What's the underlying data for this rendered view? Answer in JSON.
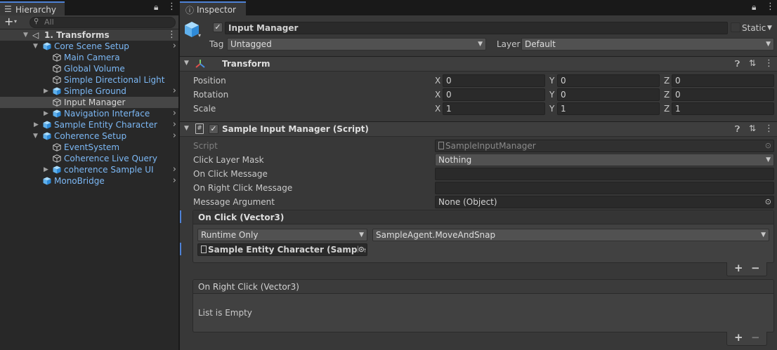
{
  "hierarchy": {
    "tab_title": "Hierarchy",
    "search_placeholder": "All",
    "scene": "1. Transforms",
    "items": [
      {
        "label": "Core Scene Setup",
        "indent": 1,
        "expanded": true,
        "children": true,
        "color": "blue"
      },
      {
        "label": "Main Camera",
        "indent": 2,
        "color": "blue"
      },
      {
        "label": "Global Volume",
        "indent": 2,
        "color": "blue"
      },
      {
        "label": "Simple Directional Light",
        "indent": 2,
        "color": "blue"
      },
      {
        "label": "Simple Ground",
        "indent": 2,
        "expanded": false,
        "children": true,
        "color": "blue"
      },
      {
        "label": "Input Manager",
        "indent": 2,
        "color": "white",
        "selected": true
      },
      {
        "label": "Navigation Interface",
        "indent": 2,
        "expanded": false,
        "children": true,
        "color": "blue"
      },
      {
        "label": "Sample Entity Character",
        "indent": 1,
        "expanded": false,
        "children": true,
        "color": "blue"
      },
      {
        "label": "Coherence Setup",
        "indent": 1,
        "expanded": true,
        "children": true,
        "color": "blue"
      },
      {
        "label": "EventSystem",
        "indent": 2,
        "color": "blue"
      },
      {
        "label": "Coherence Live Query",
        "indent": 2,
        "color": "blue"
      },
      {
        "label": "coherence Sample UI",
        "indent": 2,
        "expanded": false,
        "children": true,
        "color": "blue"
      },
      {
        "label": "MonoBridge",
        "indent": 1,
        "children": true,
        "color": "blue"
      }
    ]
  },
  "inspector": {
    "tab_title": "Inspector",
    "object_name": "Input Manager",
    "static_label": "Static",
    "tag_label": "Tag",
    "tag_value": "Untagged",
    "layer_label": "Layer",
    "layer_value": "Default",
    "transform": {
      "title": "Transform",
      "rows": [
        {
          "label": "Position",
          "x": "0",
          "y": "0",
          "z": "0"
        },
        {
          "label": "Rotation",
          "x": "0",
          "y": "0",
          "z": "0"
        },
        {
          "label": "Scale",
          "x": "1",
          "y": "1",
          "z": "1"
        }
      ]
    },
    "script_component": {
      "title": "Sample Input Manager (Script)",
      "script_label": "Script",
      "script_value": "SampleInputManager",
      "click_layer_mask_label": "Click Layer Mask",
      "click_layer_mask_value": "Nothing",
      "on_click_message_label": "On Click Message",
      "on_click_message_value": "",
      "on_right_click_message_label": "On Right Click Message",
      "on_right_click_message_value": "",
      "message_argument_label": "Message Argument",
      "message_argument_value": "None (Object)",
      "on_click_event": {
        "title": "On Click (Vector3)",
        "runtime": "Runtime Only",
        "function": "SampleAgent.MoveAndSnap",
        "target": "Sample Entity Character (Sample Ag"
      },
      "on_right_click_event": {
        "title": "On Right Click (Vector3)",
        "empty_text": "List is Empty"
      }
    }
  }
}
